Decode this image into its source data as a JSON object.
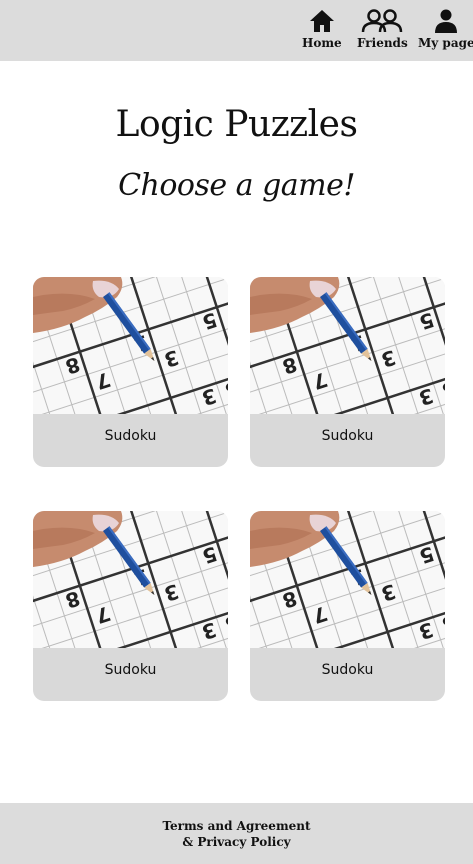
{
  "nav": {
    "items": [
      {
        "label": "Home",
        "icon": "home-icon"
      },
      {
        "label": "Friends",
        "icon": "friends-icon"
      },
      {
        "label": "My page",
        "icon": "user-icon"
      }
    ]
  },
  "main": {
    "title": "Logic Puzzles",
    "subtitle": "Choose a game!",
    "games": [
      {
        "label": "Sudoku",
        "image": "sudoku-pencil-image"
      },
      {
        "label": "Sudoku",
        "image": "sudoku-pencil-image"
      },
      {
        "label": "Sudoku",
        "image": "sudoku-pencil-image"
      },
      {
        "label": "Sudoku",
        "image": "sudoku-pencil-image"
      }
    ]
  },
  "footer": {
    "line1": "Terms and Agreement",
    "line2": "& Privacy Policy"
  },
  "colors": {
    "bar_background": "#dcdcdc",
    "card_background": "#d9d9d9",
    "page_background": "#ffffff",
    "pencil": "#1f4f9e"
  }
}
